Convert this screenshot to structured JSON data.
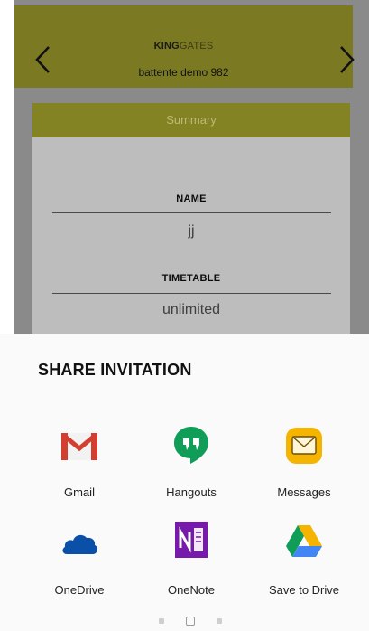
{
  "header": {
    "brand_bold": "KING",
    "brand_light": "GATES",
    "device_name": "battente demo 982"
  },
  "summary": {
    "title": "Summary",
    "name_label": "NAME",
    "name_value": "jj",
    "timetable_label": "TIMETABLE",
    "timetable_value": "unlimited"
  },
  "share": {
    "title": "SHARE INVITATION",
    "apps": [
      {
        "label": "Gmail",
        "icon": "gmail-icon"
      },
      {
        "label": "Hangouts",
        "icon": "hangouts-icon"
      },
      {
        "label": "Messages",
        "icon": "messages-icon"
      },
      {
        "label": "OneDrive",
        "icon": "onedrive-icon"
      },
      {
        "label": "OneNote",
        "icon": "onenote-icon"
      },
      {
        "label": "Save to Drive",
        "icon": "drive-icon"
      }
    ]
  },
  "pager": {
    "pages": 3,
    "current": 2
  },
  "colors": {
    "header_dimmed": "#7b7a22",
    "accent": "#b7b72e",
    "overlay": "#8a8a8a",
    "sheet_bg": "#fafafa"
  }
}
